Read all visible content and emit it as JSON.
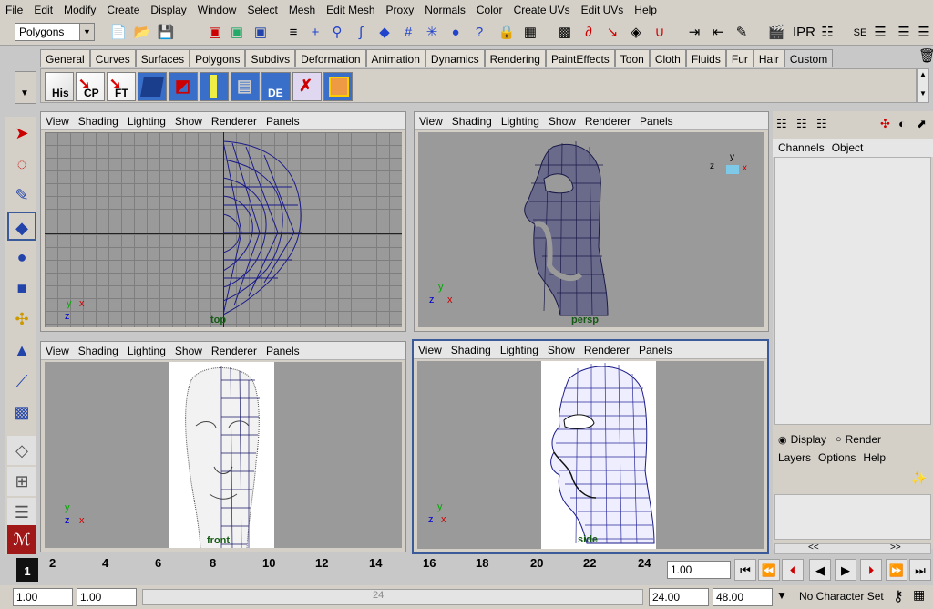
{
  "menu": [
    "File",
    "Edit",
    "Modify",
    "Create",
    "Display",
    "Window",
    "Select",
    "Mesh",
    "Edit Mesh",
    "Proxy",
    "Normals",
    "Color",
    "Create UVs",
    "Edit UVs",
    "Help"
  ],
  "mode": {
    "value": "Polygons"
  },
  "shelf_tabs": [
    "General",
    "Curves",
    "Surfaces",
    "Polygons",
    "Subdivs",
    "Deformation",
    "Animation",
    "Dynamics",
    "Rendering",
    "PaintEffects",
    "Toon",
    "Cloth",
    "Fluids",
    "Fur",
    "Hair",
    "Custom"
  ],
  "shelf_buttons": [
    "His",
    "CP",
    "FT",
    "",
    "",
    "",
    "",
    "DE",
    "",
    ""
  ],
  "panel_menu": [
    "View",
    "Shading",
    "Lighting",
    "Show",
    "Renderer",
    "Panels"
  ],
  "cameras": {
    "top": "top",
    "persp": "persp",
    "front": "front",
    "side": "side"
  },
  "axes": {
    "x": "x",
    "y": "y",
    "z": "z"
  },
  "channels": {
    "channels": "Channels",
    "object": "Object"
  },
  "layers": {
    "display": "Display",
    "render": "Render",
    "layers": "Layers",
    "options": "Options",
    "help": "Help",
    "prev": "<<",
    "next": ">>"
  },
  "timeline": {
    "ticks": [
      "2",
      "4",
      "6",
      "8",
      "10",
      "12",
      "14",
      "16",
      "18",
      "20",
      "22",
      "24"
    ],
    "current": "1",
    "frame_field": "1.00"
  },
  "range": {
    "start": "1.00",
    "playstart": "1.00",
    "thumb": "24",
    "playend": "24.00",
    "end": "48.00",
    "charset": "No Character Set"
  }
}
